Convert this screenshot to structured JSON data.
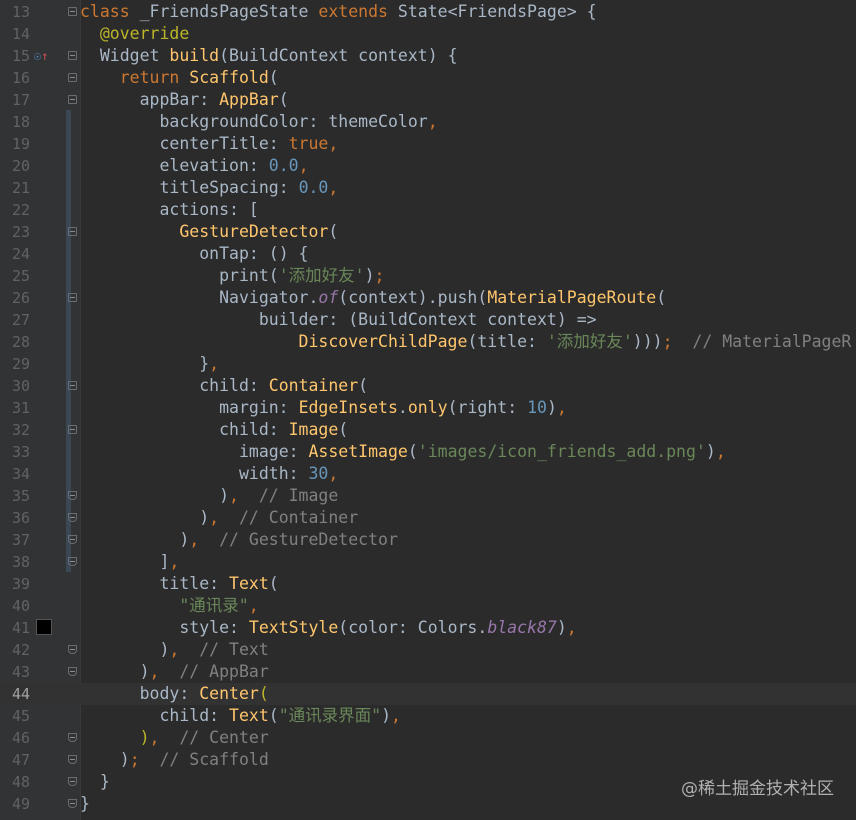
{
  "editor": {
    "lines": [
      {
        "n": "13",
        "indent": 0,
        "tokens": [
          [
            "kw",
            "class "
          ],
          [
            "plain",
            "_FriendsPageState "
          ],
          [
            "kw",
            "extends "
          ],
          [
            "plain",
            "State<FriendsPage> {"
          ]
        ]
      },
      {
        "n": "14",
        "indent": 1,
        "tokens": [
          [
            "ann",
            "@override"
          ]
        ]
      },
      {
        "n": "15",
        "indent": 1,
        "tokens": [
          [
            "plain",
            "Widget "
          ],
          [
            "fn",
            "build"
          ],
          [
            "plain",
            "(BuildContext context) {"
          ]
        ]
      },
      {
        "n": "16",
        "indent": 2,
        "tokens": [
          [
            "kw",
            "return "
          ],
          [
            "cls",
            "Scaffold"
          ],
          [
            "plain",
            "("
          ]
        ]
      },
      {
        "n": "17",
        "indent": 3,
        "tokens": [
          [
            "plain",
            "appBar: "
          ],
          [
            "cls",
            "AppBar"
          ],
          [
            "plain",
            "("
          ]
        ]
      },
      {
        "n": "18",
        "indent": 4,
        "tokens": [
          [
            "plain",
            "backgroundColor: themeColor"
          ],
          [
            "kw",
            ","
          ]
        ]
      },
      {
        "n": "19",
        "indent": 4,
        "tokens": [
          [
            "plain",
            "centerTitle: "
          ],
          [
            "kw",
            "true,"
          ]
        ]
      },
      {
        "n": "20",
        "indent": 4,
        "tokens": [
          [
            "plain",
            "elevation: "
          ],
          [
            "num",
            "0.0"
          ],
          [
            "kw",
            ","
          ]
        ]
      },
      {
        "n": "21",
        "indent": 4,
        "tokens": [
          [
            "plain",
            "titleSpacing: "
          ],
          [
            "num",
            "0.0"
          ],
          [
            "kw",
            ","
          ]
        ]
      },
      {
        "n": "22",
        "indent": 4,
        "tokens": [
          [
            "plain",
            "actions: ["
          ]
        ]
      },
      {
        "n": "23",
        "indent": 5,
        "tokens": [
          [
            "cls",
            "GestureDetector"
          ],
          [
            "plain",
            "("
          ]
        ]
      },
      {
        "n": "24",
        "indent": 6,
        "tokens": [
          [
            "plain",
            "onTap: () {"
          ]
        ]
      },
      {
        "n": "25",
        "indent": 7,
        "tokens": [
          [
            "plain",
            "print("
          ],
          [
            "str",
            "'添加好友'"
          ],
          [
            "plain",
            ")"
          ],
          [
            "kw",
            ";"
          ]
        ]
      },
      {
        "n": "26",
        "indent": 7,
        "tokens": [
          [
            "plain",
            "Navigator."
          ],
          [
            "it",
            "of"
          ],
          [
            "plain",
            "(context).push("
          ],
          [
            "cls",
            "MaterialPageRoute"
          ],
          [
            "plain",
            "("
          ]
        ]
      },
      {
        "n": "27",
        "indent": 9,
        "tokens": [
          [
            "plain",
            "builder: (BuildContext context) =>"
          ]
        ]
      },
      {
        "n": "28",
        "indent": 11,
        "tokens": [
          [
            "cls",
            "DiscoverChildPage"
          ],
          [
            "plain",
            "(title: "
          ],
          [
            "str",
            "'添加好友'"
          ],
          [
            "plain",
            ")))"
          ],
          [
            "kw",
            ";"
          ],
          [
            "cmt",
            "  // MaterialPageR"
          ]
        ]
      },
      {
        "n": "29",
        "indent": 6,
        "tokens": [
          [
            "plain",
            "}"
          ],
          [
            "kw",
            ","
          ]
        ]
      },
      {
        "n": "30",
        "indent": 6,
        "tokens": [
          [
            "plain",
            "child: "
          ],
          [
            "cls",
            "Container"
          ],
          [
            "plain",
            "("
          ]
        ]
      },
      {
        "n": "31",
        "indent": 7,
        "tokens": [
          [
            "plain",
            "margin: "
          ],
          [
            "cls",
            "EdgeInsets"
          ],
          [
            "plain",
            "."
          ],
          [
            "fn",
            "only"
          ],
          [
            "plain",
            "(right: "
          ],
          [
            "num",
            "10"
          ],
          [
            "plain",
            ")"
          ],
          [
            "kw",
            ","
          ]
        ]
      },
      {
        "n": "32",
        "indent": 7,
        "tokens": [
          [
            "plain",
            "child: "
          ],
          [
            "cls",
            "Image"
          ],
          [
            "plain",
            "("
          ]
        ]
      },
      {
        "n": "33",
        "indent": 8,
        "tokens": [
          [
            "plain",
            "image: "
          ],
          [
            "cls",
            "AssetImage"
          ],
          [
            "plain",
            "("
          ],
          [
            "str",
            "'images/icon_friends_add.png'"
          ],
          [
            "plain",
            ")"
          ],
          [
            "kw",
            ","
          ]
        ]
      },
      {
        "n": "34",
        "indent": 8,
        "tokens": [
          [
            "plain",
            "width: "
          ],
          [
            "num",
            "30"
          ],
          [
            "kw",
            ","
          ]
        ]
      },
      {
        "n": "35",
        "indent": 7,
        "tokens": [
          [
            "plain",
            ")"
          ],
          [
            "kw",
            ","
          ],
          [
            "cmt",
            "  // Image"
          ]
        ]
      },
      {
        "n": "36",
        "indent": 6,
        "tokens": [
          [
            "plain",
            ")"
          ],
          [
            "kw",
            ","
          ],
          [
            "cmt",
            "  // Container"
          ]
        ]
      },
      {
        "n": "37",
        "indent": 5,
        "tokens": [
          [
            "plain",
            ")"
          ],
          [
            "kw",
            ","
          ],
          [
            "cmt",
            "  // GestureDetector"
          ]
        ]
      },
      {
        "n": "38",
        "indent": 4,
        "tokens": [
          [
            "plain",
            "]"
          ],
          [
            "kw",
            ","
          ]
        ]
      },
      {
        "n": "39",
        "indent": 4,
        "tokens": [
          [
            "plain",
            "title: "
          ],
          [
            "cls",
            "Text"
          ],
          [
            "plain",
            "("
          ]
        ]
      },
      {
        "n": "40",
        "indent": 5,
        "tokens": [
          [
            "str",
            "\"通讯录\""
          ],
          [
            "kw",
            ","
          ]
        ]
      },
      {
        "n": "41",
        "indent": 5,
        "tokens": [
          [
            "plain",
            "style: "
          ],
          [
            "cls",
            "TextStyle"
          ],
          [
            "plain",
            "(color: Colors."
          ],
          [
            "it",
            "black87"
          ],
          [
            "plain",
            ")"
          ],
          [
            "kw",
            ","
          ]
        ]
      },
      {
        "n": "42",
        "indent": 4,
        "tokens": [
          [
            "plain",
            ")"
          ],
          [
            "kw",
            ","
          ],
          [
            "cmt",
            "  // Text"
          ]
        ]
      },
      {
        "n": "43",
        "indent": 3,
        "tokens": [
          [
            "plain",
            ")"
          ],
          [
            "kw",
            ","
          ],
          [
            "cmt",
            "  // AppBar"
          ]
        ]
      },
      {
        "n": "44",
        "indent": 3,
        "tokens": [
          [
            "plain",
            "body: "
          ],
          [
            "cls",
            "Center"
          ],
          [
            "ann",
            "("
          ]
        ]
      },
      {
        "n": "45",
        "indent": 4,
        "tokens": [
          [
            "plain",
            "child: "
          ],
          [
            "cls",
            "Text"
          ],
          [
            "plain",
            "("
          ],
          [
            "str",
            "\"通讯录界面\""
          ],
          [
            "plain",
            ")"
          ],
          [
            "kw",
            ","
          ]
        ]
      },
      {
        "n": "46",
        "indent": 3,
        "tokens": [
          [
            "ann",
            ")"
          ],
          [
            "kw",
            ","
          ],
          [
            "cmt",
            "  // Center"
          ]
        ]
      },
      {
        "n": "47",
        "indent": 2,
        "tokens": [
          [
            "plain",
            ")"
          ],
          [
            "kw",
            ";"
          ],
          [
            "cmt",
            "  // Scaffold"
          ]
        ]
      },
      {
        "n": "48",
        "indent": 1,
        "tokens": [
          [
            "plain",
            "}"
          ]
        ]
      },
      {
        "n": "49",
        "indent": 0,
        "tokens": [
          [
            "plain",
            "}"
          ]
        ]
      }
    ],
    "current_line": "44",
    "gutter_icon_line": "15",
    "color_swatch_line": "41",
    "swatch_color": "#000000"
  },
  "watermark": "@稀土掘金技术社区",
  "colors": {
    "background": "#2b2b2b",
    "keyword": "#cc7832",
    "annotation": "#bbb529",
    "class": "#ffc66d",
    "number": "#6897bb",
    "string": "#6a8759",
    "comment": "#808080"
  }
}
